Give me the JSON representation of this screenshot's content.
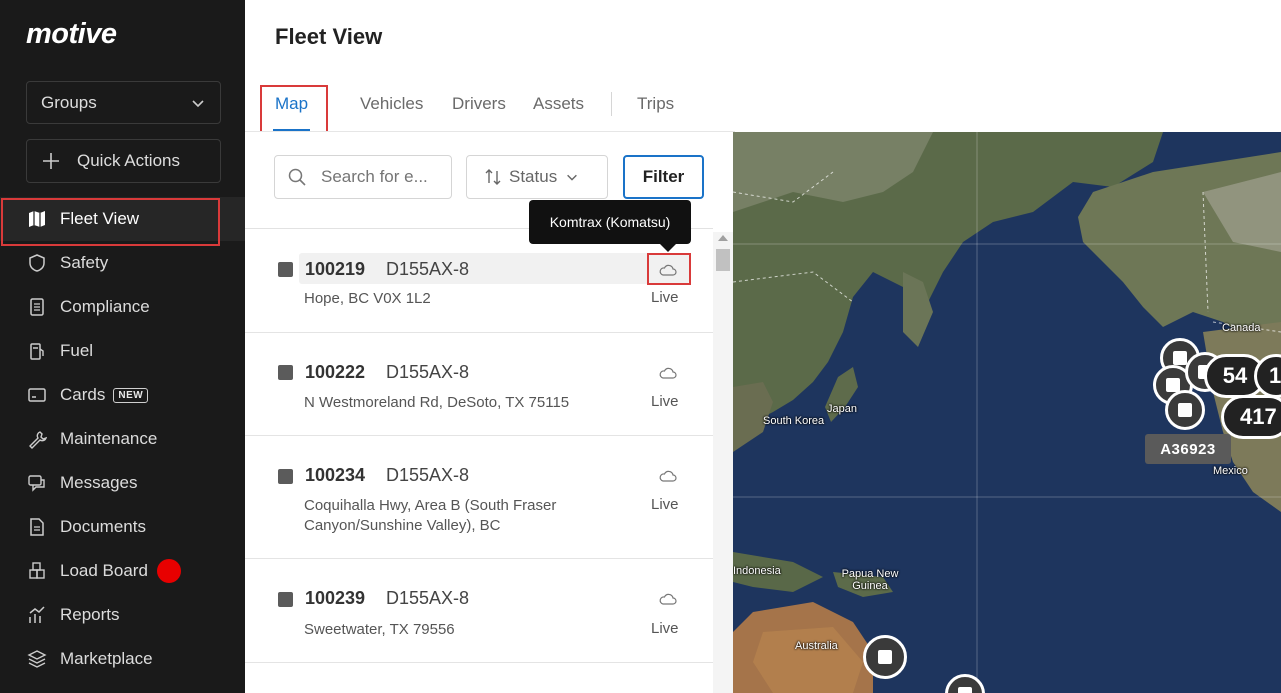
{
  "brand": {
    "logo": "motive"
  },
  "sidebar": {
    "groups_label": "Groups",
    "quick_actions_label": "Quick Actions",
    "items": [
      {
        "label": "Fleet View",
        "icon": "map-icon",
        "active": true
      },
      {
        "label": "Safety",
        "icon": "shield-icon"
      },
      {
        "label": "Compliance",
        "icon": "document-list-icon"
      },
      {
        "label": "Fuel",
        "icon": "fuel-pump-icon"
      },
      {
        "label": "Cards",
        "icon": "card-icon",
        "badge": "NEW"
      },
      {
        "label": "Maintenance",
        "icon": "wrench-icon"
      },
      {
        "label": "Messages",
        "icon": "chat-icon"
      },
      {
        "label": "Documents",
        "icon": "document-icon"
      },
      {
        "label": "Load Board",
        "icon": "load-board-icon",
        "dot_color": "#e80000"
      },
      {
        "label": "Reports",
        "icon": "chart-icon"
      },
      {
        "label": "Marketplace",
        "icon": "layers-icon"
      }
    ]
  },
  "header": {
    "title": "Fleet View",
    "tabs": [
      "Map",
      "Vehicles",
      "Drivers",
      "Assets",
      "Trips"
    ],
    "active_tab": "Map"
  },
  "toolbar": {
    "search_placeholder": "Search for e...",
    "status_label": "Status",
    "filter_label": "Filter"
  },
  "tooltip": {
    "text": "Komtrax (Komatsu)"
  },
  "vehicles": [
    {
      "id": "100219",
      "model": "D155AX-8",
      "address": "Hope, BC V0X 1L2",
      "status": "Live"
    },
    {
      "id": "100222",
      "model": "D155AX-8",
      "address": "N Westmoreland Rd, DeSoto, TX 75115",
      "status": "Live"
    },
    {
      "id": "100234",
      "model": "D155AX-8",
      "address": "Coquihalla Hwy, Area B (South Fraser Canyon/Sunshine Valley), BC",
      "status": "Live"
    },
    {
      "id": "100239",
      "model": "D155AX-8",
      "address": "Sweetwater, TX 79556",
      "status": "Live"
    }
  ],
  "map": {
    "labels": {
      "canada": "Canada",
      "japan": "Japan",
      "south_korea": "South Korea",
      "mexico": "Mexico",
      "indonesia": "Indonesia",
      "papua": "Papua New Guinea",
      "australia": "Australia"
    },
    "clusters": [
      "54",
      "1",
      "417"
    ],
    "tag": "A36923"
  },
  "colors": {
    "accent": "#1a73c8",
    "highlight_box": "#d93a3a",
    "sidebar_bg": "#1a1a1a"
  }
}
